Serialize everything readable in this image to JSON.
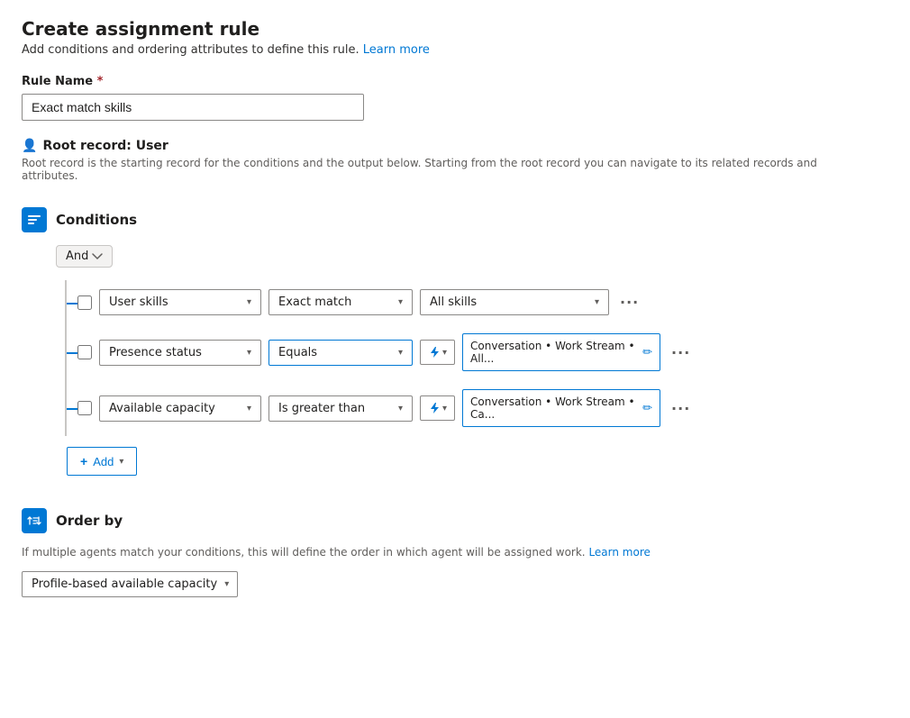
{
  "page": {
    "title": "Create assignment rule",
    "subtitle": "Add conditions and ordering attributes to define this rule.",
    "learn_more_label": "Learn more",
    "learn_more_url": "#"
  },
  "rule_name": {
    "label": "Rule Name",
    "required": true,
    "value": "Exact match skills",
    "placeholder": ""
  },
  "root_record": {
    "label": "Root record: User",
    "description": "Root record is the starting record for the conditions and the output below. Starting from the root record you can navigate to its related records and attributes."
  },
  "conditions": {
    "section_title": "Conditions",
    "logic_operator": "And",
    "rows": [
      {
        "id": "row1",
        "field": "User skills",
        "operator": "Exact match",
        "value_type": "simple",
        "value": "All skills",
        "has_lightning": false
      },
      {
        "id": "row2",
        "field": "Presence status",
        "operator": "Equals",
        "value_type": "conversation",
        "value": "Conversation • Work Stream • All...",
        "has_lightning": true
      },
      {
        "id": "row3",
        "field": "Available capacity",
        "operator": "Is greater than",
        "value_type": "conversation",
        "value": "Conversation • Work Stream • Ca...",
        "has_lightning": true
      }
    ],
    "add_button_label": "Add"
  },
  "order_by": {
    "section_title": "Order by",
    "description": "If multiple agents match your conditions, this will define the order in which agent will be assigned work.",
    "learn_more_label": "Learn more",
    "learn_more_url": "#",
    "value": "Profile-based available capacity",
    "options": [
      "Profile-based available capacity"
    ]
  }
}
